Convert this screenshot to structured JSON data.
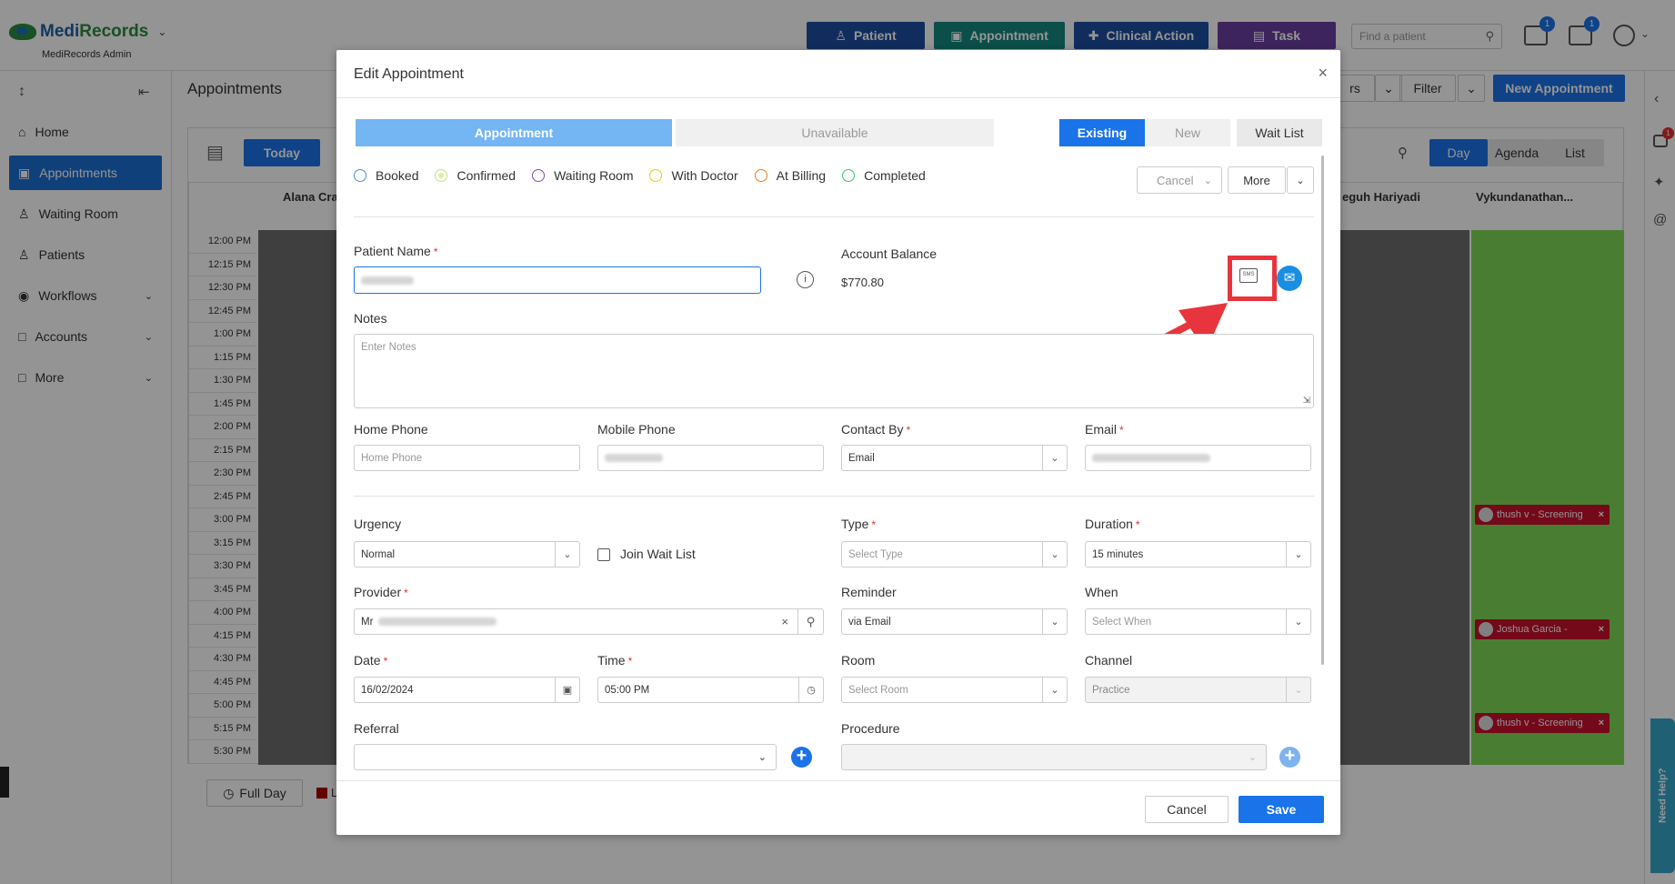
{
  "app": {
    "brand_a": "Medi",
    "brand_b": "Records",
    "subtitle": "MediRecords Admin",
    "topbar_buttons": [
      "Patient",
      "Appointment",
      "Clinical Action",
      "Task"
    ],
    "search_placeholder": "Find a patient",
    "mail_count": "1",
    "task_count": "1",
    "right_notif_count": "1",
    "need_help": "Need Help?"
  },
  "sidebar": {
    "items": [
      {
        "label": "Home"
      },
      {
        "label": "Appointments"
      },
      {
        "label": "Waiting Room"
      },
      {
        "label": "Patients"
      },
      {
        "label": "Workflows"
      },
      {
        "label": "Accounts"
      },
      {
        "label": "More"
      }
    ]
  },
  "page": {
    "title": "Appointments",
    "today": "Today",
    "filter": "Filter",
    "new_appointment": "New Appointment",
    "filter_partial": "rs",
    "view_tabs": [
      "Day",
      "Agenda",
      "List"
    ],
    "columns": [
      "Alana Cra",
      "eguh Hariyadi",
      "Vykundanathan..."
    ],
    "times": [
      "12:00 PM",
      "12:15 PM",
      "12:30 PM",
      "12:45 PM",
      "1:00 PM",
      "1:15 PM",
      "1:30 PM",
      "1:45 PM",
      "2:00 PM",
      "2:15 PM",
      "2:30 PM",
      "2:45 PM",
      "3:00 PM",
      "3:15 PM",
      "3:30 PM",
      "3:45 PM",
      "4:00 PM",
      "4:15 PM",
      "4:30 PM",
      "4:45 PM",
      "5:00 PM",
      "5:15 PM",
      "5:30 PM"
    ],
    "appointments": [
      {
        "label": "thush v - Screening"
      },
      {
        "label": "Joshua Garcia -"
      },
      {
        "label": "thush v - Screening"
      }
    ],
    "full_day": "Full Day",
    "legend_partial": "L"
  },
  "modal": {
    "title": "Edit Appointment",
    "tabs": [
      "Appointment",
      "Unavailable"
    ],
    "modes": [
      "Existing",
      "New",
      "Wait List"
    ],
    "statuses": [
      {
        "label": "Booked",
        "color": "#4a90d9"
      },
      {
        "label": "Confirmed",
        "color": "#9acd32"
      },
      {
        "label": "Waiting Room",
        "color": "#8e44ad"
      },
      {
        "label": "With Doctor",
        "color": "#f1c40f"
      },
      {
        "label": "At Billing",
        "color": "#e67e22"
      },
      {
        "label": "Completed",
        "color": "#2ecc71"
      }
    ],
    "cancel_menu": "Cancel",
    "more_menu": "More",
    "patient_name_label": "Patient Name",
    "account_balance_label": "Account Balance",
    "account_balance": "$770.80",
    "sms_icon_text": "SMS",
    "notes_label": "Notes",
    "notes_placeholder": "Enter Notes",
    "home_phone_label": "Home Phone",
    "home_phone_placeholder": "Home Phone",
    "mobile_phone_label": "Mobile Phone",
    "contact_by_label": "Contact By",
    "contact_by_value": "Email",
    "email_label": "Email",
    "urgency_label": "Urgency",
    "urgency_value": "Normal",
    "join_wait_list": "Join Wait List",
    "type_label": "Type",
    "type_placeholder": "Select Type",
    "duration_label": "Duration",
    "duration_value": "15 minutes",
    "provider_label": "Provider",
    "provider_value": "Mr",
    "reminder_label": "Reminder",
    "reminder_value": "via Email",
    "when_label": "When",
    "when_placeholder": "Select When",
    "date_label": "Date",
    "date_value": "16/02/2024",
    "time_label": "Time",
    "time_value": "05:00 PM",
    "room_label": "Room",
    "room_placeholder": "Select Room",
    "channel_label": "Channel",
    "channel_value": "Practice",
    "referral_label": "Referral",
    "procedure_label": "Procedure",
    "cancel_button": "Cancel",
    "save_button": "Save"
  },
  "colors": {
    "primary": "#1a73e8",
    "appointment_btn": "#16877e",
    "clinical_btn": "#1c4fa0",
    "task_btn": "#6b3fa0",
    "highlight": "#e8353d"
  }
}
